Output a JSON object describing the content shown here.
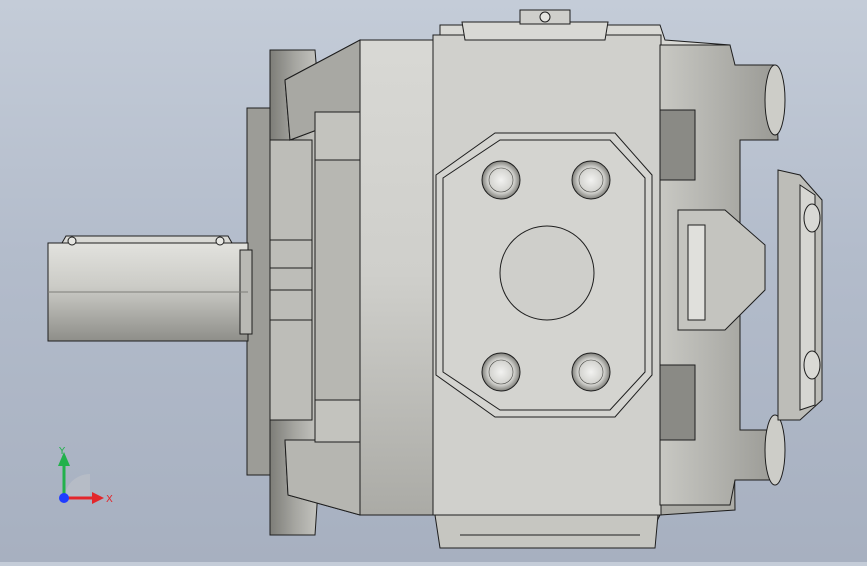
{
  "viewport": {
    "background_top": "#c4ccd8",
    "background_bottom": "#a7b0c0"
  },
  "model": {
    "body_color": "#cfcfcb",
    "shadow_color": "#8f8f8a",
    "edge_color": "#1e1e1e",
    "shaft_color": "#c9c9c4"
  },
  "triad": {
    "y_label": "Y",
    "x_label": "X",
    "y_color": "#22b14c",
    "x_color": "#e3262b",
    "z_color": "#1f3cff"
  }
}
